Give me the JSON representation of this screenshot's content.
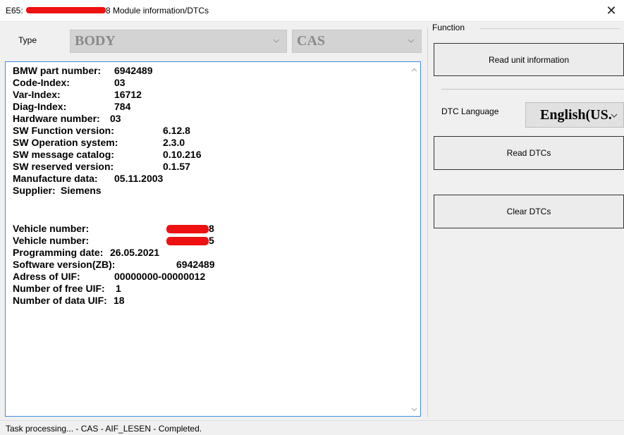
{
  "window": {
    "title_prefix": "E65:",
    "title_suffix": "8 Module information/DTCs"
  },
  "selectors": {
    "type_label": "Type",
    "module_group": "BODY",
    "module": "CAS"
  },
  "info_lines": [
    {
      "key": "BMW part number:",
      "value": "6942489"
    },
    {
      "key": "Code-Index:",
      "value": "03"
    },
    {
      "key": "Var-Index:",
      "value": "16712"
    },
    {
      "key": "Diag-Index:",
      "value": "784"
    },
    {
      "key": "Hardware number:",
      "value": "03"
    },
    {
      "key": "SW Function version:",
      "value": "6.12.8"
    },
    {
      "key": "SW Operation system:",
      "value": "2.3.0"
    },
    {
      "key": "SW message catalog:",
      "value": "0.10.216"
    },
    {
      "key": "SW reserved version:",
      "value": "0.1.57"
    },
    {
      "key": "Manufacture data:",
      "value": "05.11.2003"
    },
    {
      "key": "Supplier:",
      "value": "Siemens"
    },
    {
      "key": "Vehicle number:",
      "value": "8"
    },
    {
      "key": "Vehicle number:",
      "value": "5"
    },
    {
      "key": "Programming date:",
      "value": "26.05.2021"
    },
    {
      "key": "Software version(ZB):",
      "value": "6942489"
    },
    {
      "key": "Adress of UIF:",
      "value": "00000000-00000012"
    },
    {
      "key": "Number of free UIF:",
      "value": "1"
    },
    {
      "key": "Number of data UIF:",
      "value": "18"
    }
  ],
  "function_panel": {
    "legend": "Function",
    "read_unit_info": "Read unit information",
    "dtc_language_label": "DTC Language",
    "dtc_language_value": "English(US.",
    "read_dtcs": "Read DTCs",
    "clear_dtcs": "Clear DTCs"
  },
  "status": {
    "text": "Task processing... - CAS - AIF_LESEN - Completed."
  },
  "colors": {
    "redaction": "#ee1111",
    "focus_border": "#3c8ce0"
  }
}
